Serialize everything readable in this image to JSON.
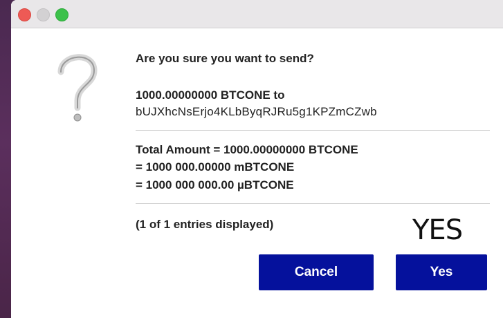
{
  "dialog": {
    "question": "Are you sure you want to send?",
    "amount_line": "1000.00000000 BTCONE to",
    "recipient_address": "bUJXhcNsErjo4KLbByqRJRu5g1KPZmCZwb",
    "total_line": "Total Amount = 1000.00000000 BTCONE",
    "mbtcone_line": "= 1000 000.00000 mBTCONE",
    "ubtcone_line": "= 1000 000 000.00 µBTCONE",
    "entries_text": "(1 of 1 entries displayed)",
    "icon": "question-mark-icon"
  },
  "overlay": {
    "annotation": "YES"
  },
  "buttons": {
    "cancel_label": "Cancel",
    "yes_label": "Yes"
  },
  "colors": {
    "button_bg": "#05119c",
    "button_text": "#ffffff",
    "background": "#5b2f5d"
  }
}
